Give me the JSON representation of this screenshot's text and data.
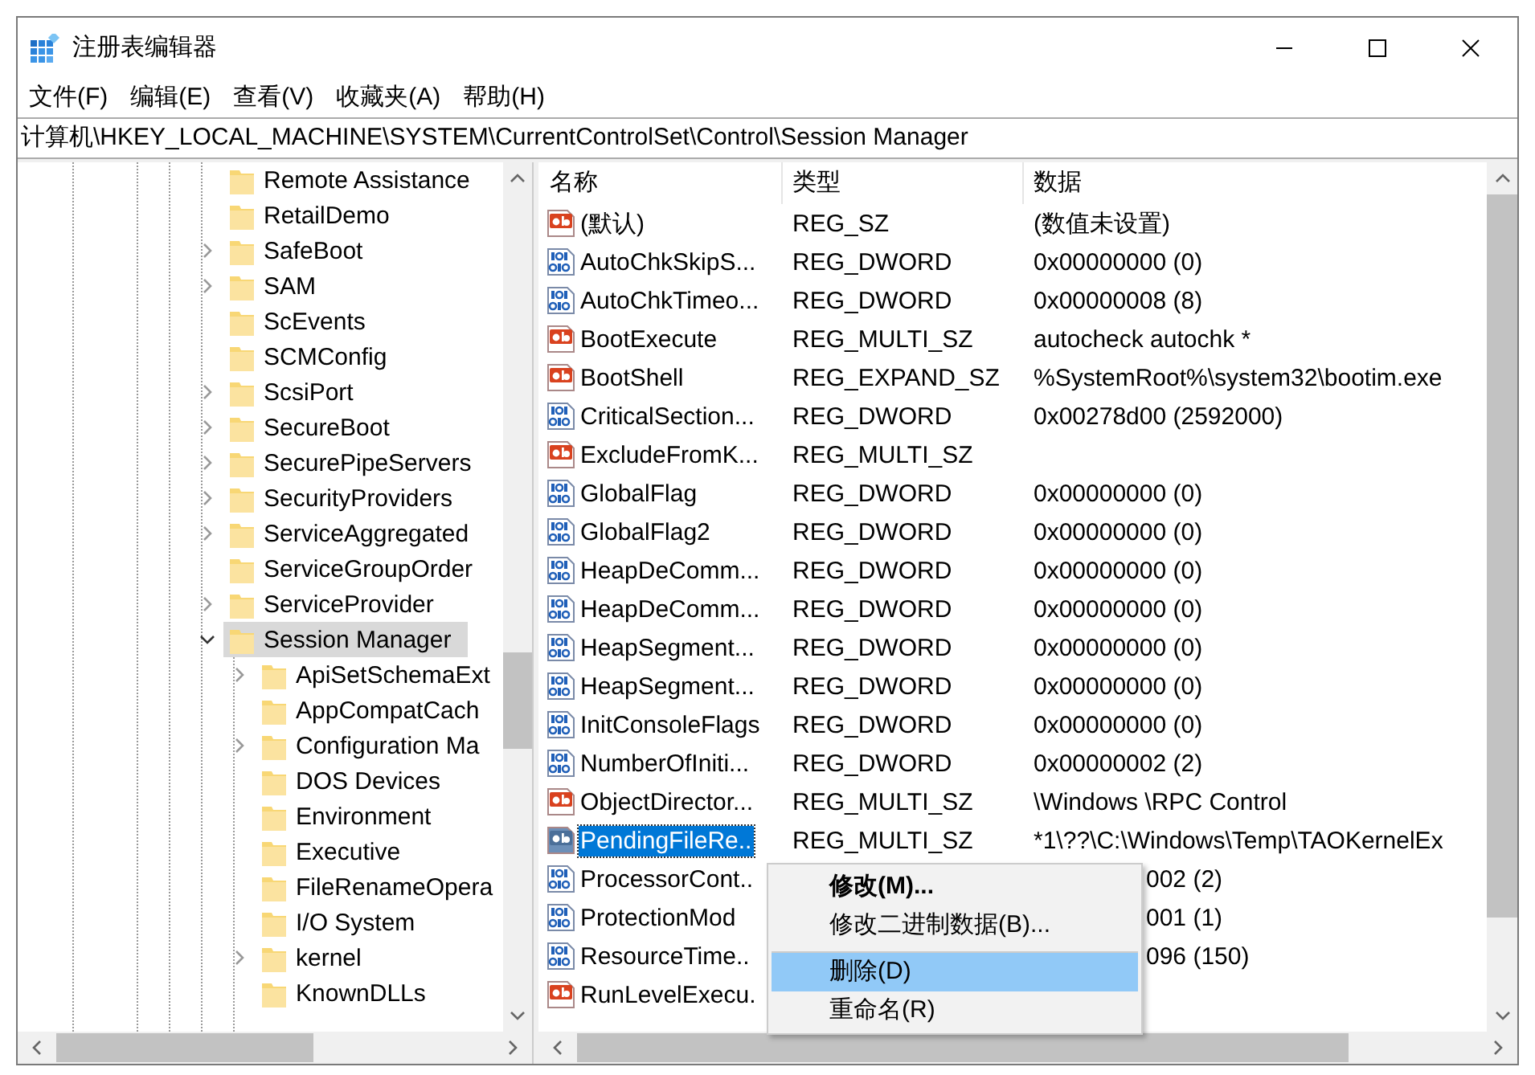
{
  "window": {
    "title": "注册表编辑器"
  },
  "menu": [
    "文件(F)",
    "编辑(E)",
    "查看(V)",
    "收藏夹(A)",
    "帮助(H)"
  ],
  "address": "计算机\\HKEY_LOCAL_MACHINE\\SYSTEM\\CurrentControlSet\\Control\\Session Manager",
  "tree": {
    "items": [
      {
        "label": "Remote Assistance",
        "selected": false
      },
      {
        "label": "RetailDemo",
        "selected": false
      },
      {
        "label": "SafeBoot",
        "expanded": false,
        "selected": false
      },
      {
        "label": "SAM",
        "expanded": false,
        "selected": false
      },
      {
        "label": "ScEvents",
        "selected": false
      },
      {
        "label": "SCMConfig",
        "selected": false
      },
      {
        "label": "ScsiPort",
        "expanded": false,
        "selected": false
      },
      {
        "label": "SecureBoot",
        "expanded": false,
        "selected": false
      },
      {
        "label": "SecurePipeServers",
        "expanded": false,
        "selected": false
      },
      {
        "label": "SecurityProviders",
        "expanded": false,
        "selected": false
      },
      {
        "label": "ServiceAggregated",
        "expanded": false,
        "selected": false
      },
      {
        "label": "ServiceGroupOrder",
        "selected": false
      },
      {
        "label": "ServiceProvider",
        "expanded": false,
        "selected": false
      },
      {
        "label": "Session Manager",
        "expanded": true,
        "selected": true,
        "children": [
          {
            "label": "ApiSetSchemaExt",
            "expanded": false,
            "selected": false
          },
          {
            "label": "AppCompatCach",
            "selected": false
          },
          {
            "label": "Configuration Ma",
            "expanded": false,
            "selected": false
          },
          {
            "label": "DOS Devices",
            "selected": false
          },
          {
            "label": "Environment",
            "selected": false
          },
          {
            "label": "Executive",
            "selected": false
          },
          {
            "label": "FileRenameOpera",
            "selected": false
          },
          {
            "label": "I/O System",
            "selected": false
          },
          {
            "label": "kernel",
            "expanded": false,
            "selected": false
          },
          {
            "label": "KnownDLLs",
            "selected": false
          }
        ]
      }
    ]
  },
  "table": {
    "columns": [
      "名称",
      "类型",
      "数据"
    ],
    "rows": [
      {
        "kind": "string",
        "name": "(默认)",
        "type": "REG_SZ",
        "data": "(数值未设置)",
        "selected": false
      },
      {
        "kind": "binary",
        "name": "AutoChkSkipS...",
        "type": "REG_DWORD",
        "data": "0x00000000 (0)",
        "selected": false
      },
      {
        "kind": "binary",
        "name": "AutoChkTimeo...",
        "type": "REG_DWORD",
        "data": "0x00000008 (8)",
        "selected": false
      },
      {
        "kind": "string",
        "name": "BootExecute",
        "type": "REG_MULTI_SZ",
        "data": "autocheck autochk *",
        "selected": false
      },
      {
        "kind": "string",
        "name": "BootShell",
        "type": "REG_EXPAND_SZ",
        "data": "%SystemRoot%\\system32\\bootim.exe",
        "selected": false
      },
      {
        "kind": "binary",
        "name": "CriticalSection...",
        "type": "REG_DWORD",
        "data": "0x00278d00 (2592000)",
        "selected": false
      },
      {
        "kind": "string",
        "name": "ExcludeFromK...",
        "type": "REG_MULTI_SZ",
        "selected": false
      },
      {
        "kind": "binary",
        "name": "GlobalFlag",
        "type": "REG_DWORD",
        "data": "0x00000000 (0)",
        "selected": false
      },
      {
        "kind": "binary",
        "name": "GlobalFlag2",
        "type": "REG_DWORD",
        "data": "0x00000000 (0)",
        "selected": false
      },
      {
        "kind": "binary",
        "name": "HeapDeComm...",
        "type": "REG_DWORD",
        "data": "0x00000000 (0)",
        "selected": false
      },
      {
        "kind": "binary",
        "name": "HeapDeComm...",
        "type": "REG_DWORD",
        "data": "0x00000000 (0)",
        "selected": false
      },
      {
        "kind": "binary",
        "name": "HeapSegment...",
        "type": "REG_DWORD",
        "data": "0x00000000 (0)",
        "selected": false
      },
      {
        "kind": "binary",
        "name": "HeapSegment...",
        "type": "REG_DWORD",
        "data": "0x00000000 (0)",
        "selected": false
      },
      {
        "kind": "binary",
        "name": "InitConsoleFlags",
        "type": "REG_DWORD",
        "data": "0x00000000 (0)",
        "selected": false
      },
      {
        "kind": "binary",
        "name": "NumberOfIniti...",
        "type": "REG_DWORD",
        "data": "0x00000002 (2)",
        "selected": false
      },
      {
        "kind": "string",
        "name": "ObjectDirector...",
        "type": "REG_MULTI_SZ",
        "data": "\\Windows \\RPC Control",
        "selected": false
      },
      {
        "kind": "string",
        "name": "PendingFileRe..",
        "type": "REG_MULTI_SZ",
        "data": "*1\\??\\C:\\Windows\\Temp\\TAOKernelEx",
        "selected": true
      },
      {
        "kind": "binary",
        "name": "ProcessorCont..",
        "data": "002 (2)",
        "selected": false
      },
      {
        "kind": "binary",
        "name": "ProtectionMod",
        "data": "001 (1)",
        "selected": false
      },
      {
        "kind": "binary",
        "name": "ResourceTime..",
        "data": "096 (150)",
        "selected": false
      },
      {
        "kind": "string",
        "name": "RunLevelExecu.",
        "selected": false
      }
    ]
  },
  "context_menu": [
    {
      "label": "修改(M)...",
      "default": true,
      "separator_before": false,
      "selected": false
    },
    {
      "label": "修改二进制数据(B)...",
      "default": false,
      "separator_before": false,
      "selected": false
    },
    {
      "label": "删除(D)",
      "default": false,
      "separator_before": true,
      "selected": true
    },
    {
      "label": "重命名(R)",
      "default": false,
      "separator_before": false,
      "selected": false
    }
  ]
}
